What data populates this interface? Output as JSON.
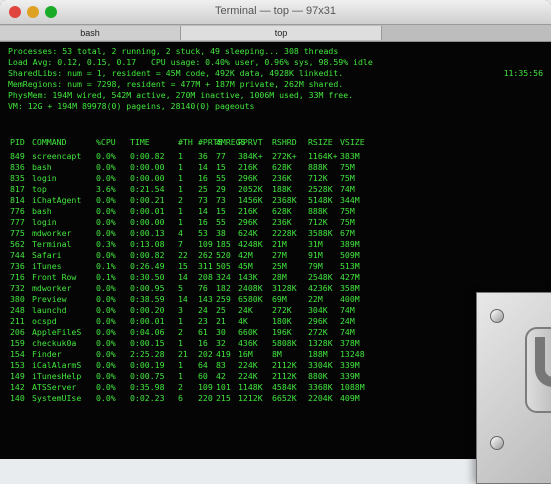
{
  "window": {
    "title": "Terminal — top — 97x31",
    "tabs": [
      "bash",
      "top"
    ]
  },
  "summary_lines": [
    "Processes: 53 total, 2 running, 2 stuck, 49 sleeping... 308 threads",
    "Load Avg: 0.12, 0.15, 0.17   CPU usage: 0.40% user, 0.96% sys, 98.59% idle",
    "SharedLibs: num = 1, resident = 45M code, 492K data, 4928K linkedit.",
    "MemRegions: num = 7298, resident = 477M + 187M private, 262M shared.",
    "PhysMem: 194M wired, 542M active, 270M inactive, 1006M used, 33M free.",
    "VM: 12G + 194M 89978(0) pageins, 28140(0) pageouts"
  ],
  "right_note": "11:35:56",
  "columns": [
    "PID",
    "COMMAND",
    "%CPU",
    "TIME",
    "#TH",
    "#PRTS",
    "#MREGS",
    "RPRVT",
    "RSHRD",
    "RSIZE",
    "VSIZE"
  ],
  "rows": [
    [
      "849",
      "screencapt",
      "0.0%",
      "0:00.82",
      "1",
      "36",
      "77",
      "384K+",
      "272K+",
      "1164K+",
      "383M"
    ],
    [
      "836",
      "bash",
      "0.0%",
      "0:00.00",
      "1",
      "14",
      "15",
      "216K",
      "628K",
      "888K",
      "75M"
    ],
    [
      "835",
      "login",
      "0.0%",
      "0:00.00",
      "1",
      "16",
      "55",
      "296K",
      "236K",
      "712K",
      "75M"
    ],
    [
      "817",
      "top",
      "3.6%",
      "0:21.54",
      "1",
      "25",
      "29",
      "2052K",
      "188K",
      "2528K",
      "74M"
    ],
    [
      "814",
      "iChatAgent",
      "0.0%",
      "0:00.21",
      "2",
      "73",
      "73",
      "1456K",
      "2368K",
      "5148K",
      "344M"
    ],
    [
      "776",
      "bash",
      "0.0%",
      "0:00.01",
      "1",
      "14",
      "15",
      "216K",
      "628K",
      "888K",
      "75M"
    ],
    [
      "777",
      "login",
      "0.0%",
      "0:00.00",
      "1",
      "16",
      "55",
      "296K",
      "236K",
      "712K",
      "75M"
    ],
    [
      "775",
      "mdworker",
      "0.0%",
      "0:00.13",
      "4",
      "53",
      "38",
      "624K",
      "2228K",
      "3588K",
      "67M"
    ],
    [
      "562",
      "Terminal",
      "0.3%",
      "0:13.08",
      "7",
      "109",
      "185",
      "4248K",
      "21M",
      "31M",
      "389M"
    ],
    [
      "744",
      "Safari",
      "0.0%",
      "0:00.82",
      "22",
      "262",
      "520",
      "42M",
      "27M",
      "91M",
      "509M"
    ],
    [
      "736",
      "iTunes",
      "0.1%",
      "0:26.49",
      "15",
      "311",
      "505",
      "45M",
      "25M",
      "79M",
      "513M"
    ],
    [
      "716",
      "Front Row",
      "0.1%",
      "0:30.50",
      "14",
      "208",
      "324",
      "143K",
      "28M",
      "2548K",
      "427M"
    ],
    [
      "732",
      "mdworker",
      "0.0%",
      "0:00.95",
      "5",
      "76",
      "182",
      "2408K",
      "3128K",
      "4236K",
      "358M"
    ],
    [
      "380",
      "Preview",
      "0.0%",
      "0:38.59",
      "14",
      "143",
      "259",
      "6580K",
      "69M",
      "22M",
      "400M"
    ],
    [
      "248",
      "launchd",
      "0.0%",
      "0:00.20",
      "3",
      "24",
      "25",
      "24K",
      "272K",
      "304K",
      "74M"
    ],
    [
      "211",
      "ocspd",
      "0.0%",
      "0:00.01",
      "1",
      "23",
      "21",
      "4K",
      "180K",
      "296K",
      "24M"
    ],
    [
      "206",
      "AppleFileS",
      "0.0%",
      "0:04.06",
      "2",
      "61",
      "30",
      "660K",
      "196K",
      "272K",
      "74M"
    ],
    [
      "159",
      "checkuk0a",
      "0.0%",
      "0:00.15",
      "1",
      "16",
      "32",
      "436K",
      "5808K",
      "1328K",
      "378M"
    ],
    [
      "154",
      "Finder",
      "0.0%",
      "2:25.28",
      "21",
      "202",
      "419",
      "16M",
      "8M",
      "188M",
      "13248"
    ],
    [
      "153",
      "iCalAlarmS",
      "0.0%",
      "0:00.19",
      "1",
      "64",
      "83",
      "224K",
      "2112K",
      "3304K",
      "339M"
    ],
    [
      "149",
      "iTunesHelp",
      "0.0%",
      "0:00.75",
      "1",
      "60",
      "42",
      "224K",
      "2112K",
      "880K",
      "339M"
    ],
    [
      "142",
      "ATSServer",
      "0.0%",
      "0:35.98",
      "2",
      "109",
      "101",
      "1148K",
      "4584K",
      "3368K",
      "1088M"
    ],
    [
      "140",
      "SystemUIse",
      "0.0%",
      "0:02.23",
      "6",
      "220",
      "215",
      "1212K",
      "6652K",
      "2204K",
      "409M"
    ]
  ],
  "colors": {
    "terminal_bg": "#050505",
    "terminal_text": "#41e73d"
  }
}
